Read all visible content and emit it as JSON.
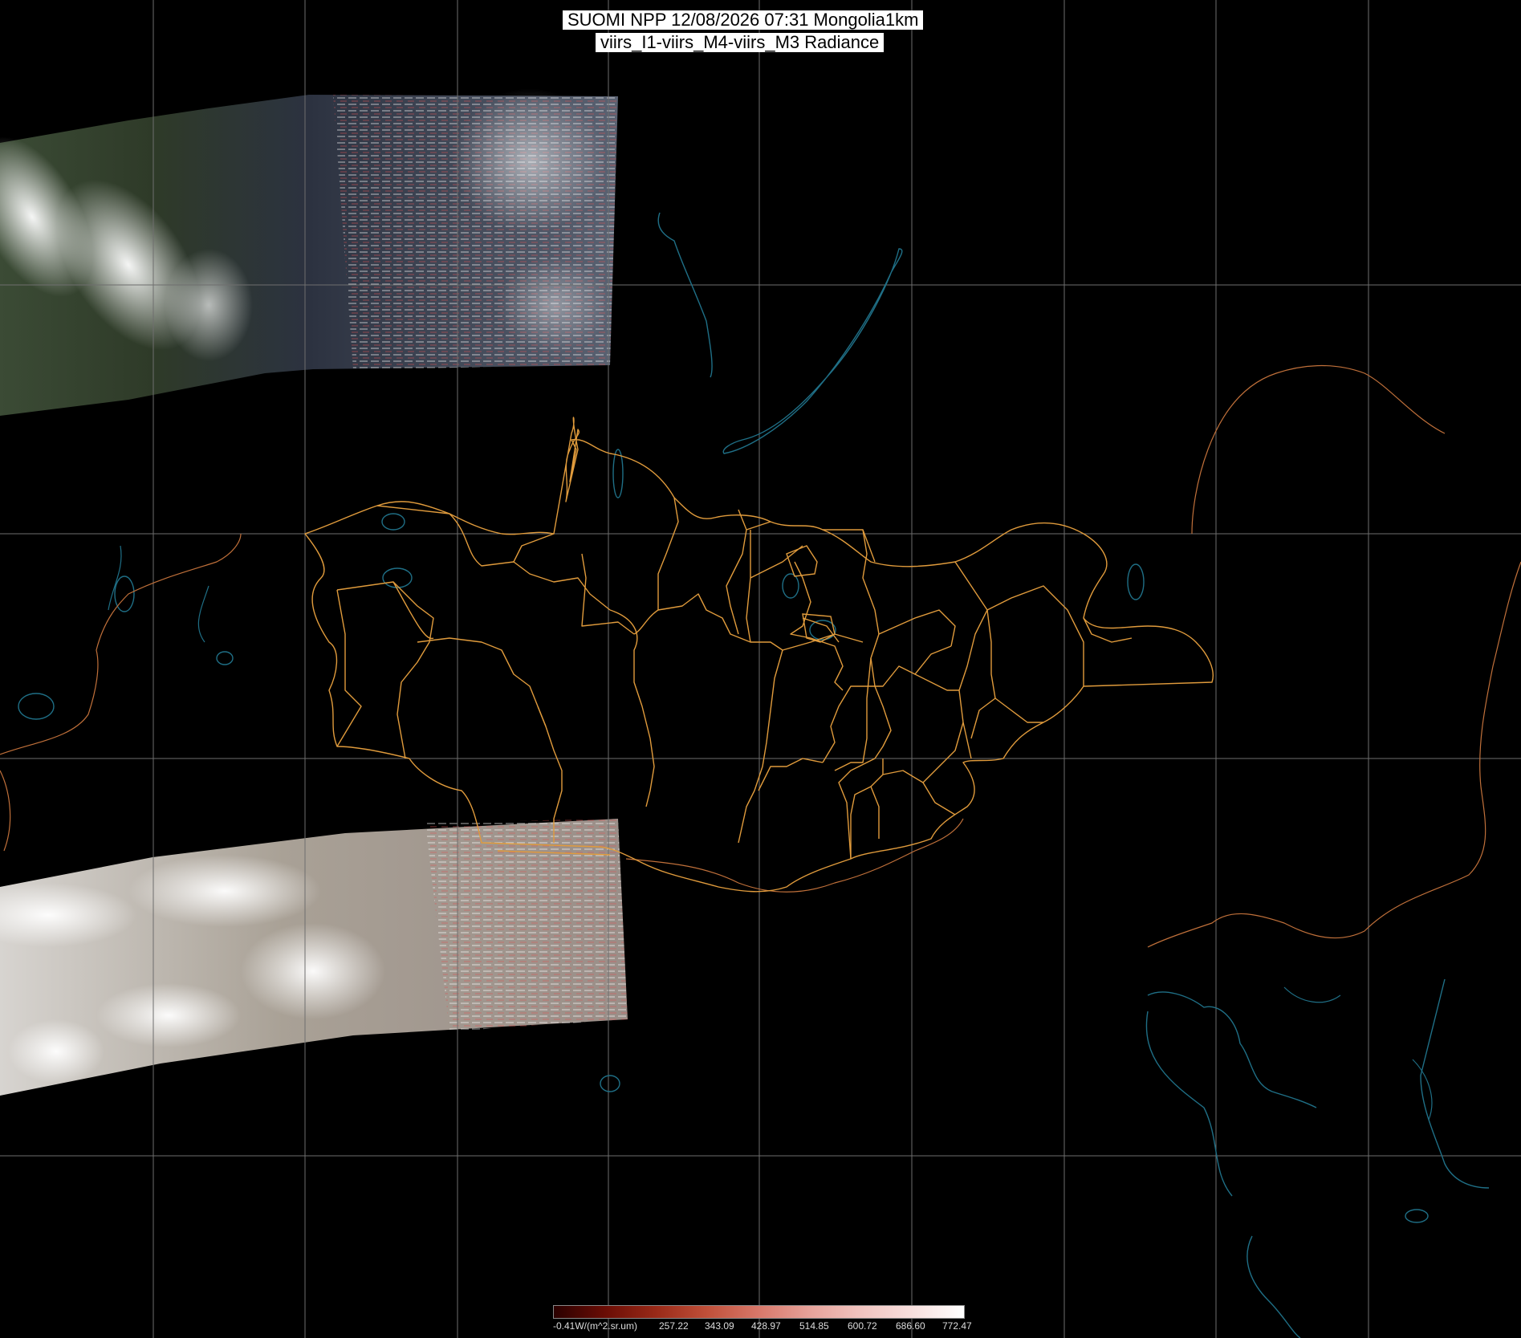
{
  "title": {
    "line1": "SUOMI NPP 12/08/2026 07:31 Mongolia1km",
    "line2": "viirs_I1-viirs_M4-viirs_M3 Radiance"
  },
  "colorbar": {
    "unit_label": "-0.41W/(m^2.sr.um)",
    "tick_labels": [
      "257.22",
      "343.09",
      "428.97",
      "514.85",
      "600.72",
      "686.60",
      "772.47"
    ],
    "colors": [
      "#2a0000",
      "#6a0d05",
      "#9a2a18",
      "#c0503a",
      "#d8786a",
      "#e6a29a",
      "#f1c4c0",
      "#f8e0de",
      "#ffffff"
    ]
  },
  "map_layers": {
    "grid_color": "#6e6e6e",
    "coastline_color": "#1f6f86",
    "border_color": "#e09b3c",
    "country_line_color": "#c0703a"
  }
}
